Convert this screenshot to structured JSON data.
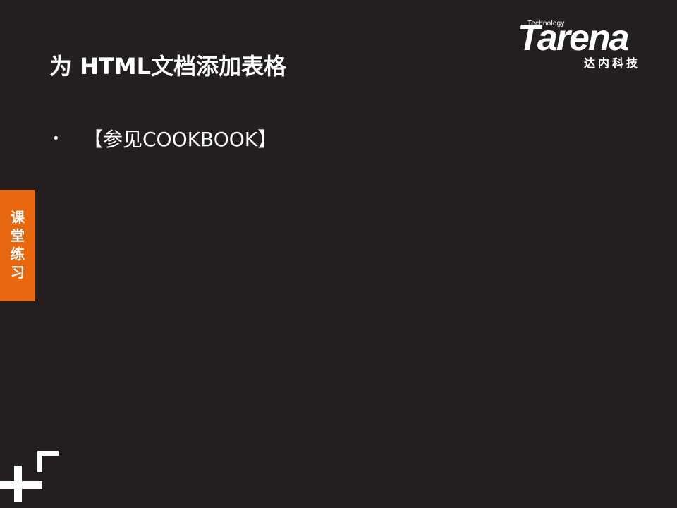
{
  "logo": {
    "tagline": "Technology",
    "wordmark": "Tarena",
    "chinese": "达内科技"
  },
  "slide": {
    "title": "为 HTML文档添加表格",
    "bullets": [
      {
        "marker": "•",
        "text": "【参见COOKBOOK】"
      }
    ]
  },
  "side_tab": {
    "label": "课堂练习",
    "color": "#e8680f"
  },
  "decoration": {
    "icon": "plus-icon",
    "color": "#ffffff"
  },
  "background_color": "#231f20"
}
